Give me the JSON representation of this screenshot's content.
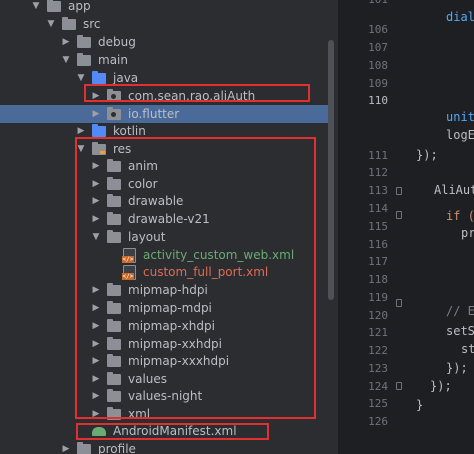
{
  "project_tree": {
    "items": [
      {
        "label": "app",
        "icon": "folder-icon",
        "expanded": true
      },
      {
        "label": "src",
        "icon": "folder-icon",
        "expanded": true
      },
      {
        "label": "debug",
        "icon": "folder-icon",
        "expanded": false
      },
      {
        "label": "main",
        "icon": "folder-icon",
        "expanded": true
      },
      {
        "label": "java",
        "icon": "folder-blue-icon",
        "expanded": true
      },
      {
        "label": "com.sean.rao.aliAuth",
        "icon": "package-icon",
        "expanded": false
      },
      {
        "label": "io.flutter",
        "icon": "package-icon",
        "expanded": false
      },
      {
        "label": "kotlin",
        "icon": "folder-blue-icon",
        "expanded": false
      },
      {
        "label": "res",
        "icon": "res-folder-icon",
        "expanded": true
      },
      {
        "label": "anim",
        "icon": "folder-icon",
        "expanded": false
      },
      {
        "label": "color",
        "icon": "folder-icon",
        "expanded": false
      },
      {
        "label": "drawable",
        "icon": "folder-icon",
        "expanded": false
      },
      {
        "label": "drawable-v21",
        "icon": "folder-icon",
        "expanded": false
      },
      {
        "label": "layout",
        "icon": "folder-icon",
        "expanded": true
      },
      {
        "label": "activity_custom_web.xml",
        "icon": "xml-file-icon",
        "status": "added"
      },
      {
        "label": "custom_full_port.xml",
        "icon": "xml-file-icon",
        "status": "untracked"
      },
      {
        "label": "mipmap-hdpi",
        "icon": "folder-icon",
        "expanded": false
      },
      {
        "label": "mipmap-mdpi",
        "icon": "folder-icon",
        "expanded": false
      },
      {
        "label": "mipmap-xhdpi",
        "icon": "folder-icon",
        "expanded": false
      },
      {
        "label": "mipmap-xxhdpi",
        "icon": "folder-icon",
        "expanded": false
      },
      {
        "label": "mipmap-xxxhdpi",
        "icon": "folder-icon",
        "expanded": false
      },
      {
        "label": "values",
        "icon": "folder-icon",
        "expanded": false
      },
      {
        "label": "values-night",
        "icon": "folder-icon",
        "expanded": false
      },
      {
        "label": "xml",
        "icon": "folder-icon",
        "expanded": false
      },
      {
        "label": "AndroidManifest.xml",
        "icon": "android-manifest-icon"
      },
      {
        "label": "profile",
        "icon": "folder-icon",
        "expanded": false
      }
    ],
    "selected_item": "io.flutter"
  },
  "editor": {
    "current_line": "110",
    "line_numbers": [
      "101",
      "106",
      "107",
      "108",
      "109",
      "110",
      "111",
      "112",
      "113",
      "114",
      "115",
      "116",
      "117",
      "118",
      "119",
      "120",
      "121",
      "122",
      "123",
      "124",
      "125",
      "126"
    ],
    "code_lines": [
      {
        "text": "dial",
        "style": "fn"
      },
      {
        "text": "unit",
        "style": "fn"
      },
      {
        "text": "logE",
        "style": "plain"
      },
      {
        "text": "});",
        "style": "plain"
      },
      {
        "text": "AliAut",
        "style": "plain"
      },
      {
        "text": "if (",
        "style": "kw"
      },
      {
        "text": "pr",
        "style": "plain"
      },
      {
        "text": "// E",
        "style": "cm"
      },
      {
        "text": "setS",
        "style": "plain"
      },
      {
        "text": "st",
        "style": "plain"
      },
      {
        "text": "});",
        "style": "plain"
      },
      {
        "text": "});",
        "style": "plain"
      },
      {
        "text": "}",
        "style": "plain"
      }
    ]
  },
  "colors": {
    "selection": "#4a6a9a",
    "highlight_box": "#e03030",
    "git_added": "#6aab73",
    "git_untracked": "#e06c53"
  }
}
